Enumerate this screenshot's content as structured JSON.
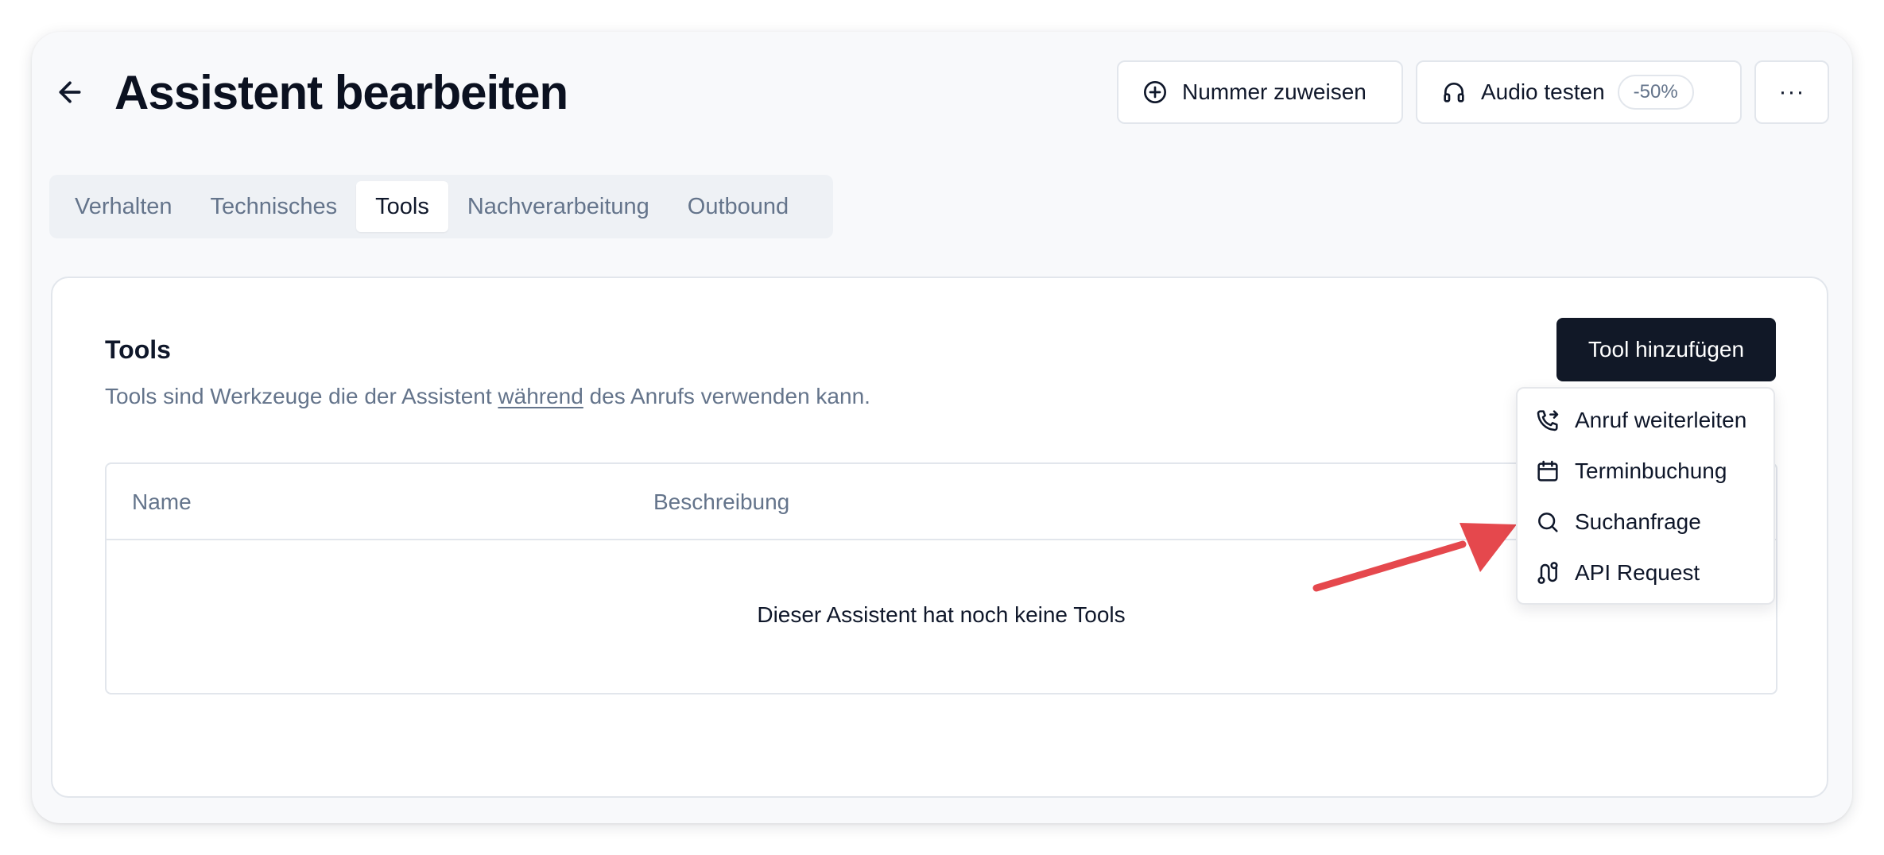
{
  "header": {
    "title": "Assistent bearbeiten",
    "assign_number_label": "Nummer zuweisen",
    "test_audio_label": "Audio testen",
    "test_audio_badge": "-50%",
    "more_label": "···"
  },
  "tabs": [
    {
      "label": "Verhalten",
      "active": false
    },
    {
      "label": "Technisches",
      "active": false
    },
    {
      "label": "Tools",
      "active": true
    },
    {
      "label": "Nachverarbeitung",
      "active": false
    },
    {
      "label": "Outbound",
      "active": false
    }
  ],
  "tools_section": {
    "title": "Tools",
    "desc_before": "Tools sind Werkzeuge die der Assistent ",
    "desc_underlined": "während",
    "desc_after": " des Anrufs verwenden kann.",
    "add_button_label": "Tool hinzufügen",
    "table": {
      "columns": [
        "Name",
        "Beschreibung"
      ],
      "empty_text": "Dieser Assistent hat noch keine Tools"
    }
  },
  "dropdown": {
    "items": [
      {
        "label": "Anruf weiterleiten",
        "icon": "phone-forward-icon"
      },
      {
        "label": "Terminbuchung",
        "icon": "calendar-icon"
      },
      {
        "label": "Suchanfrage",
        "icon": "search-icon"
      },
      {
        "label": "API Request",
        "icon": "route-icon"
      }
    ]
  },
  "colors": {
    "primary_button": "#111827",
    "annotation_arrow": "#e5484d",
    "muted_text": "#64748b"
  }
}
